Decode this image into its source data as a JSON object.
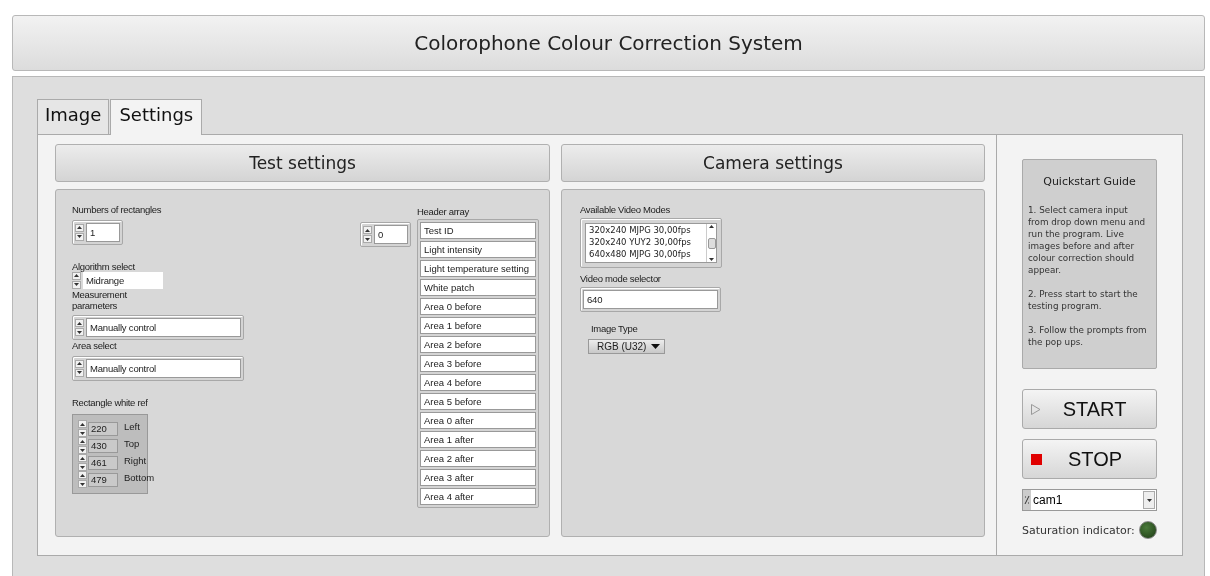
{
  "window": {
    "title": "Colorophone Colour Correction System"
  },
  "tabs": [
    {
      "label": "Image",
      "selected": false
    },
    {
      "label": "Settings",
      "selected": true
    }
  ],
  "test_settings": {
    "title": "Test settings",
    "numbers_of_rectangles": {
      "label": "Numbers of rectangles",
      "value": "1"
    },
    "algorithm_select": {
      "label": "Algorithm select",
      "value": "Midrange"
    },
    "measurement_parameters": {
      "label": "Measurement parameters",
      "value": "Manually control"
    },
    "area_select": {
      "label": "Area select",
      "value": "Manually control"
    },
    "rectangle_white_ref": {
      "label": "Rectangle white ref",
      "fields": [
        {
          "value": "220",
          "label": "Left"
        },
        {
          "value": "430",
          "label": "Top"
        },
        {
          "value": "461",
          "label": "Right"
        },
        {
          "value": "479",
          "label": "Bottom"
        }
      ]
    },
    "header_array": {
      "label": "Header array",
      "index": "0",
      "items": [
        "Test ID",
        "Light intensity",
        "Light temperature setting",
        "White patch",
        "Area 0 before",
        "Area 1 before",
        "Area 2 before",
        "Area 3 before",
        "Area 4 before",
        "Area 5 before",
        "Area 0 after",
        "Area 1 after",
        "Area 2 after",
        "Area 3 after",
        "Area 4 after"
      ]
    }
  },
  "camera_settings": {
    "title": "Camera settings",
    "available_video_modes": {
      "label": "Available Video Modes",
      "items": [
        "320x240 MJPG 30,00fps",
        "320x240 YUY2 30,00fps",
        "640x480 MJPG 30,00fps"
      ]
    },
    "video_mode_selector": {
      "label": "Video mode selector",
      "value": "640"
    },
    "image_type": {
      "label": "Image Type",
      "value": "RGB (U32)"
    }
  },
  "quickstart": {
    "title": "Quickstart Guide",
    "steps": [
      "1. Select camera input from drop down menu and run the program. Live images before and after colour correction should appear.",
      "2. Press start to start the testing program.",
      "3. Follow the prompts from the pop ups."
    ]
  },
  "buttons": [
    {
      "label": "START",
      "kind": "start"
    },
    {
      "label": "STOP",
      "kind": "stop"
    }
  ],
  "camera_select": {
    "value": "cam1"
  },
  "saturation_indicator": {
    "label": "Saturation indicator:",
    "on": false
  }
}
